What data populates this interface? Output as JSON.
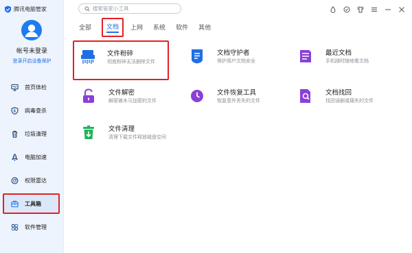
{
  "app": {
    "brand": "腾讯电脑管家"
  },
  "account": {
    "name": "帐号未登录",
    "login_link": "登录开启设备保护"
  },
  "sidebar": {
    "items": [
      {
        "label": "首页体检",
        "icon": "monitor-icon"
      },
      {
        "label": "病毒查杀",
        "icon": "shield-icon"
      },
      {
        "label": "垃圾清理",
        "icon": "trash-icon"
      },
      {
        "label": "电脑加速",
        "icon": "rocket-icon"
      },
      {
        "label": "权限雷达",
        "icon": "radar-icon"
      },
      {
        "label": "工具箱",
        "icon": "toolbox-icon",
        "active": true
      },
      {
        "label": "软件管理",
        "icon": "apps-icon"
      }
    ]
  },
  "search": {
    "placeholder": "搜索管家小工具"
  },
  "tabs": [
    {
      "label": "全部"
    },
    {
      "label": "文档",
      "active": true
    },
    {
      "label": "上网"
    },
    {
      "label": "系统"
    },
    {
      "label": "软件"
    },
    {
      "label": "其他"
    }
  ],
  "tools": [
    {
      "name": "文件粉碎",
      "desc": "彻底粉碎无法删除文件",
      "icon": "shredder-icon",
      "color": "#1f6fe3"
    },
    {
      "name": "文档守护者",
      "desc": "保护用户文档安全",
      "icon": "document-guard-icon",
      "color": "#1f6fe3"
    },
    {
      "name": "最近文档",
      "desc": "手机随时随地看文档",
      "icon": "recent-document-icon",
      "color": "#8b3fd8"
    },
    {
      "name": "文件解密",
      "desc": "解密被木马加密的文件",
      "icon": "unlock-icon",
      "color": "#8b3fd8"
    },
    {
      "name": "文件恢复工具",
      "desc": "恢复意外丢失的文件",
      "icon": "file-recovery-icon",
      "color": "#8b3fd8"
    },
    {
      "name": "文档找回",
      "desc": "找回误删或痛失的文件",
      "icon": "document-search-icon",
      "color": "#8b3fd8"
    },
    {
      "name": "文件清理",
      "desc": "清理下载文件释放磁盘空间",
      "icon": "file-clean-icon",
      "color": "#22b35e"
    }
  ]
}
